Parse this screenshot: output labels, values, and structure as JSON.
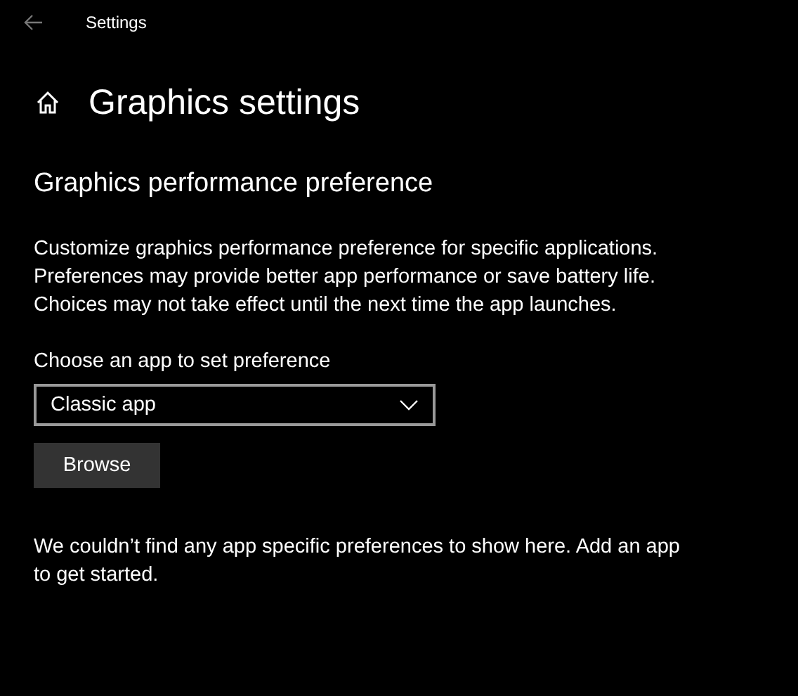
{
  "window": {
    "title": "Settings"
  },
  "page": {
    "title": "Graphics settings"
  },
  "section": {
    "heading": "Graphics performance preference",
    "description": "Customize graphics performance preference for specific applications. Preferences may provide better app performance or save battery life. Choices may not take effect until the next time the app launches.",
    "dropdown_label": "Choose an app to set preference",
    "dropdown_value": "Classic app",
    "browse_button": "Browse",
    "empty_message": "We couldn’t find any app specific preferences to show here. Add an app to get started."
  }
}
